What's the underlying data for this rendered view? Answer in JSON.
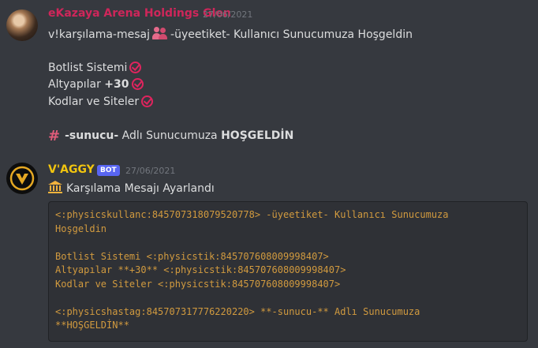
{
  "messages": [
    {
      "author": "eKazaya Arena Holdings Glen",
      "author_color": "#e0245e",
      "timestamp": "27/06/2021",
      "lines": {
        "l1_pre": "v!karşılama-mesaj",
        "l1_post": "-üyeetiket- Kullanıcı Sunucumuza Hoşgeldin",
        "l2": "Botlist Sistemi",
        "l3_pre": "Altyapılar",
        "l3_bold": "+30",
        "l4": "Kodlar ve Siteler",
        "l5_bold": "-sunucu-",
        "l5_mid": "Adlı Sunucumuza",
        "l5_bold2": "HOŞGELDİN"
      }
    },
    {
      "author": "V'AGGY",
      "author_color": "#f1c40f",
      "badge": "BOT",
      "timestamp": "27/06/2021",
      "text": "Karşılama Mesajı Ayarlandı",
      "code_lines": [
        "<:physicskullanc:845707318079520778> -üyeetiket- Kullanıcı Sunucumuza",
        "Hoşgeldin",
        "",
        "Botlist Sistemi <:physicstik:845707608009998407>",
        "Altyapılar **+30** <:physicstik:845707608009998407>",
        "Kodlar ve Siteler <:physicstik:845707608009998407>",
        "",
        "<:physicshastag:845707317776220220> **-sunucu-** Adlı Sunucumuza",
        "**HOŞGELDİN**"
      ]
    }
  ],
  "icons": {
    "check": "check-circle-icon",
    "people": "people-icon",
    "hash": "hashtag-icon",
    "bank": "bank-icon",
    "bot_logo": "v-logo-icon"
  }
}
